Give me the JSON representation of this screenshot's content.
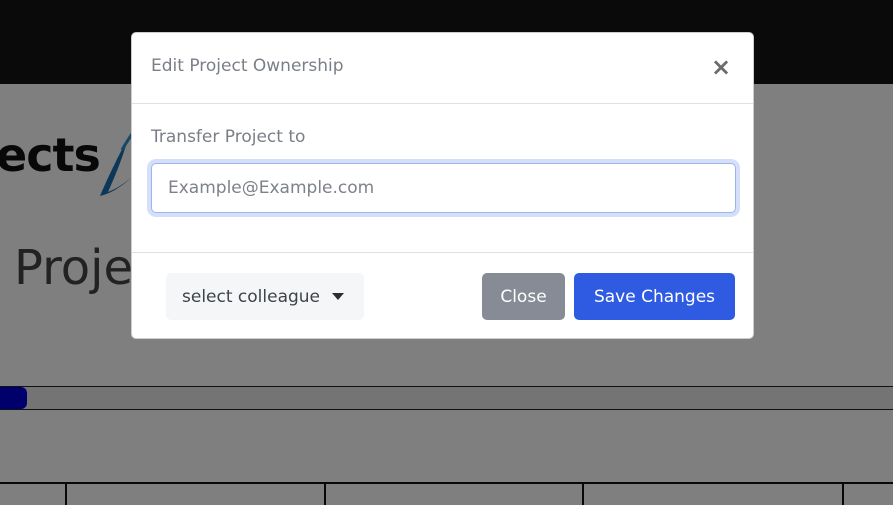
{
  "background": {
    "logo_text": "ects",
    "page_title": "Proje",
    "progress": 0.03,
    "colors": {
      "topbar": "#141414",
      "progress_fill": "#0000d8"
    }
  },
  "modal": {
    "title": "Edit Project Ownership",
    "close_icon": "×",
    "field_label": "Transfer Project to",
    "email_placeholder": "Example@Example.com",
    "email_value": "",
    "colleague_dropdown_label": "select colleague",
    "close_button_label": "Close",
    "save_button_label": "Save Changes",
    "colors": {
      "primary": "#2f5be2",
      "secondary": "#868b96"
    }
  }
}
